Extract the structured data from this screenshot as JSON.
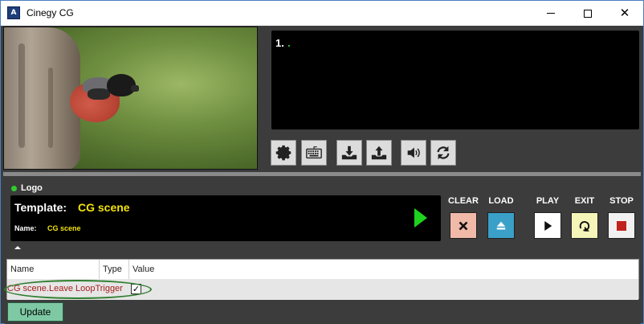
{
  "window": {
    "title": "Cinegy CG",
    "app_icon_glyph": "A",
    "controls": [
      "minimize",
      "maximize",
      "close"
    ]
  },
  "text_monitor": {
    "line_number": "1.",
    "cursor": "."
  },
  "toolbar": {
    "buttons": [
      {
        "icon": "gear-icon"
      },
      {
        "icon": "keyboard-icon"
      },
      {
        "icon": "download-icon"
      },
      {
        "icon": "upload-icon"
      },
      {
        "icon": "speaker-icon"
      },
      {
        "icon": "refresh-icon"
      }
    ]
  },
  "logo_panel": {
    "label": "Logo",
    "template_key": "Template:",
    "template_value": "CG scene",
    "name_key": "Name:",
    "name_value": "CG scene"
  },
  "controls": {
    "clear_label": "CLEAR",
    "load_label": "LOAD",
    "play_label": "PLAY",
    "exit_label": "EXIT",
    "stop_label": "STOP"
  },
  "table": {
    "columns": [
      "Name",
      "Type",
      "Value"
    ],
    "rows": [
      {
        "name": "CG scene.Leave LoopTrigger",
        "type": "",
        "value_checked": true
      }
    ]
  },
  "update_label": "Update",
  "colors": {
    "accent_green": "#1ed31e",
    "template_yellow": "#f2e20c",
    "update_button": "#7ec9a4"
  }
}
